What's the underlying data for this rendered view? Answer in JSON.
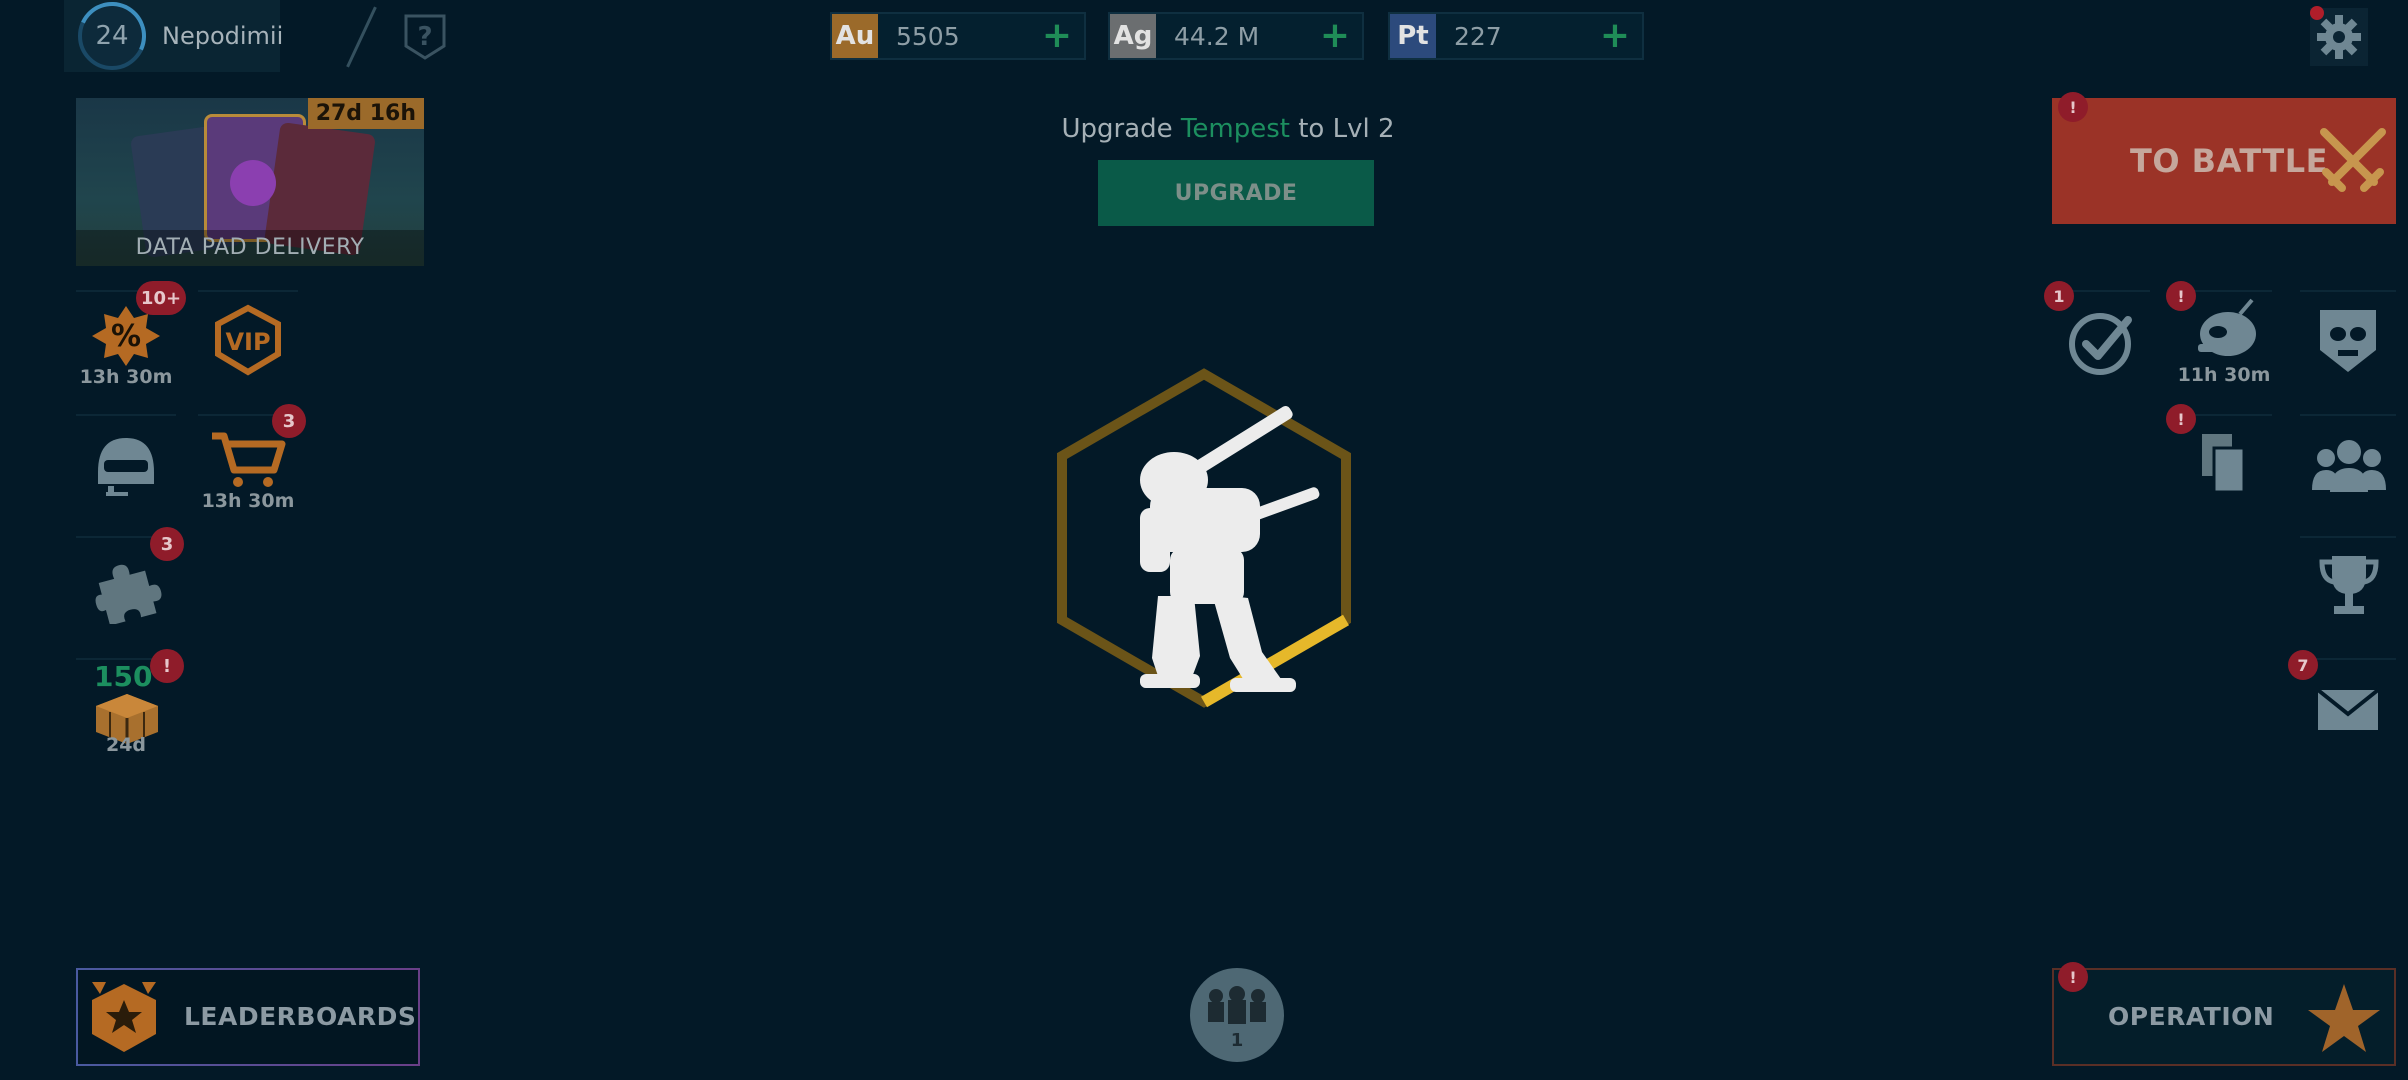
{
  "player": {
    "level": "24",
    "name": "Nepodimii",
    "help_icon": "question-shield-icon"
  },
  "currencies": [
    {
      "code": "Au",
      "value": "5505",
      "color": "#9b6a2a"
    },
    {
      "code": "Ag",
      "value": "44.2 M",
      "color": "#6b6e70"
    },
    {
      "code": "Pt",
      "value": "227",
      "color": "#2c4a7c"
    }
  ],
  "datapad": {
    "timer": "27d 16h",
    "label": "DATA PAD DELIVERY"
  },
  "left_menu": {
    "sale": {
      "badge": "10+",
      "timer": "13h 30m",
      "icon": "discount-burst-icon"
    },
    "vip": {
      "label": "VIP",
      "icon": "vip-shield-icon"
    },
    "pilots": {
      "icon": "pilot-helmet-icon"
    },
    "shop": {
      "badge": "3",
      "timer": "13h 30m",
      "icon": "shopping-cart-icon"
    },
    "puzzle": {
      "badge": "3",
      "icon": "puzzle-piece-icon"
    },
    "crate": {
      "count": "150",
      "badge": "!",
      "timer": "24d",
      "icon": "crate-icon"
    }
  },
  "center": {
    "upgrade_prefix": "Upgrade ",
    "upgrade_robot": "Tempest",
    "upgrade_suffix": " to Lvl 2",
    "upgrade_button": "UPGRADE"
  },
  "right_menu": {
    "battle": {
      "label": "TO BATTLE",
      "badge": "!"
    },
    "tasks": {
      "badge": "1",
      "icon": "checkmark-circle-icon"
    },
    "event": {
      "badge": "!",
      "timer": "11h 30m",
      "icon": "alien-head-icon"
    },
    "skull": {
      "icon": "skull-shield-icon"
    },
    "cards": {
      "badge": "!",
      "icon": "copy-cards-icon"
    },
    "clan": {
      "icon": "group-people-icon"
    },
    "trophy": {
      "icon": "trophy-icon"
    },
    "mail": {
      "badge": "7",
      "icon": "mail-envelope-icon"
    }
  },
  "bottom": {
    "leaderboards": "LEADERBOARDS",
    "clan_count": "1",
    "operation": "OPERATION",
    "operation_badge": "!"
  },
  "colors": {
    "background": "#031927",
    "accent_green": "#1c8f5f",
    "battle_red": "#9b3327",
    "badge_red": "#8f1c2a",
    "gold": "#c9a32a"
  }
}
